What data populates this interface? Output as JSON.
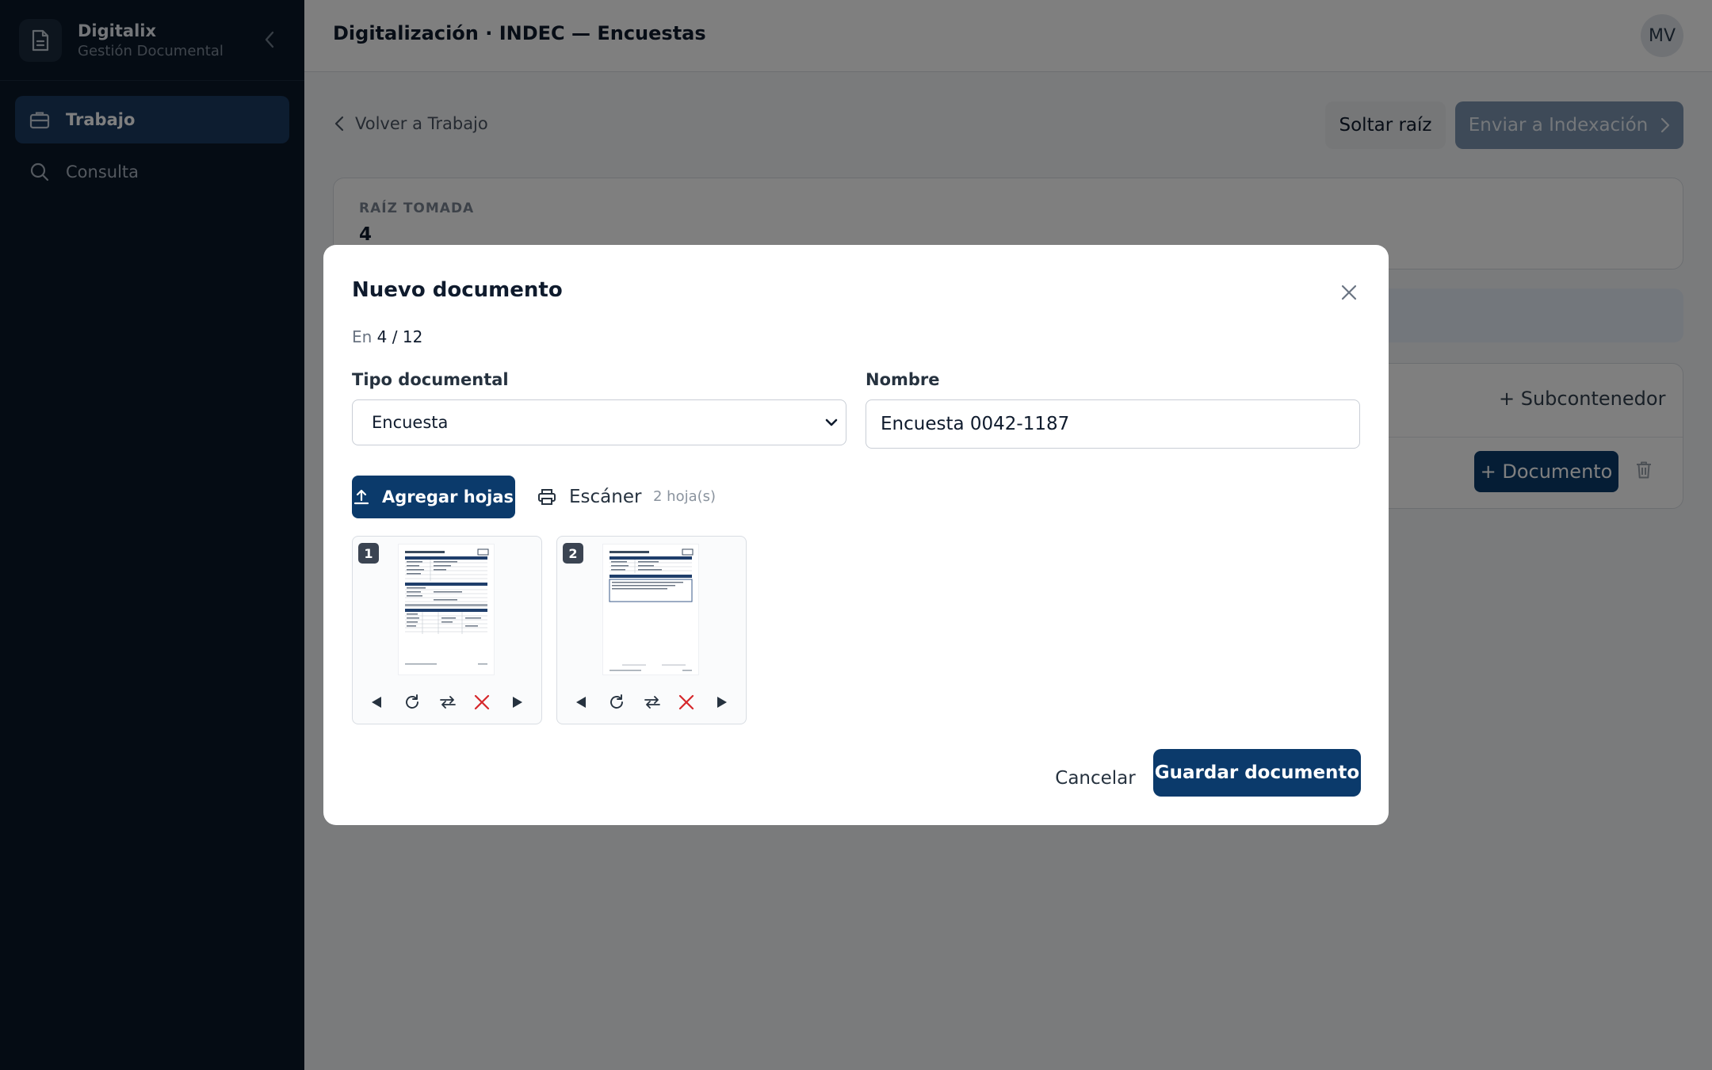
{
  "sidebar": {
    "brand_name": "Digitalix",
    "brand_sub": "Gestión Documental",
    "items": [
      {
        "label": "Trabajo",
        "icon": "briefcase-icon",
        "active": true
      },
      {
        "label": "Consulta",
        "icon": "search-icon",
        "active": false
      }
    ]
  },
  "header": {
    "title": "Digitalización · INDEC — Encuestas",
    "avatar": "MV"
  },
  "page": {
    "back_label": "Volver a Trabajo",
    "soltar_label": "Soltar raíz",
    "enviar_label": "Enviar a Indexación",
    "raiz_label": "RAÍZ TOMADA",
    "raiz_value": "4",
    "subcontenedor_label": "+ Subcontenedor",
    "documento_label": "+ Documento"
  },
  "modal": {
    "title": "Nuevo documento",
    "sub_prefix": "En",
    "sub_path": "4 / 12",
    "tipo_label": "Tipo documental",
    "tipo_value": "Encuesta",
    "nombre_label": "Nombre",
    "nombre_value": "Encuesta 0042-1187",
    "agregar_label": "Agregar hojas",
    "escaner_label": "Escáner",
    "sheet_count": "2 hoja(s)",
    "thumbs": [
      {
        "num": "1"
      },
      {
        "num": "2"
      }
    ],
    "cancel_label": "Cancelar",
    "save_label": "Guardar documento"
  },
  "colors": {
    "sidebar_bg": "#0b1829",
    "primary": "#0b3a6b",
    "danger": "#d6282c"
  }
}
